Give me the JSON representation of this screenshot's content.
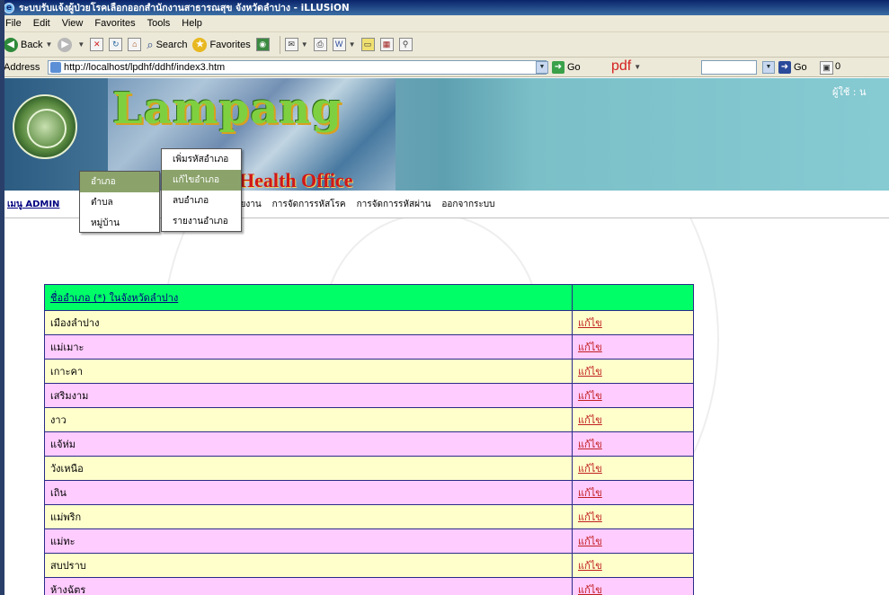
{
  "window": {
    "title": "ระบบรับแจ้งผู้ป่วยโรคเลือกออกสำนักงานสาธารณสุข จังหวัดลำปาง - iLLUSiON"
  },
  "menubar": [
    "File",
    "Edit",
    "View",
    "Favorites",
    "Tools",
    "Help"
  ],
  "toolbar": {
    "back": "Back",
    "search": "Search",
    "favorites": "Favorites"
  },
  "address": {
    "label": "Address",
    "url": "http://localhost/lpdhf/ddhf/index3.htm",
    "go": "Go",
    "pdf": "pdf",
    "go2": "Go"
  },
  "banner": {
    "brand": "Lampang",
    "office": "Health Office",
    "user": "ผู้ใช้ : น"
  },
  "nav": {
    "admin": "เมนู ADMIN",
    "items": [
      "หน่วยงาน",
      "การจัดการรหัสโรค",
      "การจัดการรหัสผ่าน",
      "ออกจากระบบ"
    ]
  },
  "menu_level1": [
    "อำเภอ",
    "ตำบล",
    "หมู่บ้าน"
  ],
  "menu_level2": [
    "เพิ่มรหัสอำเภอ",
    "แก้ไขอำเภอ",
    "ลบอำเภอ",
    "รายงานอำเภอ"
  ],
  "table": {
    "header": "ชื่ออำเภอ (*) ในจังหวัดลำปาง",
    "rows": [
      {
        "name": "เมืองลำปาง",
        "action": "แก้ไข"
      },
      {
        "name": "แม่เมาะ",
        "action": "แก้ไข"
      },
      {
        "name": "เกาะคา",
        "action": "แก้ไข"
      },
      {
        "name": "เสริมงาม",
        "action": "แก้ไข"
      },
      {
        "name": "งาว",
        "action": "แก้ไข"
      },
      {
        "name": "แจ้ห่ม",
        "action": "แก้ไข"
      },
      {
        "name": "วังเหนือ",
        "action": "แก้ไข"
      },
      {
        "name": "เถิน",
        "action": "แก้ไข"
      },
      {
        "name": "แม่พริก",
        "action": "แก้ไข"
      },
      {
        "name": "แม่ทะ",
        "action": "แก้ไข"
      },
      {
        "name": "สบปราบ",
        "action": "แก้ไข"
      },
      {
        "name": "ห้างฉัตร",
        "action": "แก้ไข"
      }
    ]
  },
  "colors": {
    "header_green": "#00ff66",
    "row_yellow": "#ffffcc",
    "row_pink": "#ffccff",
    "menu_active": "#8ba36b",
    "edit_link": "#c02020"
  }
}
